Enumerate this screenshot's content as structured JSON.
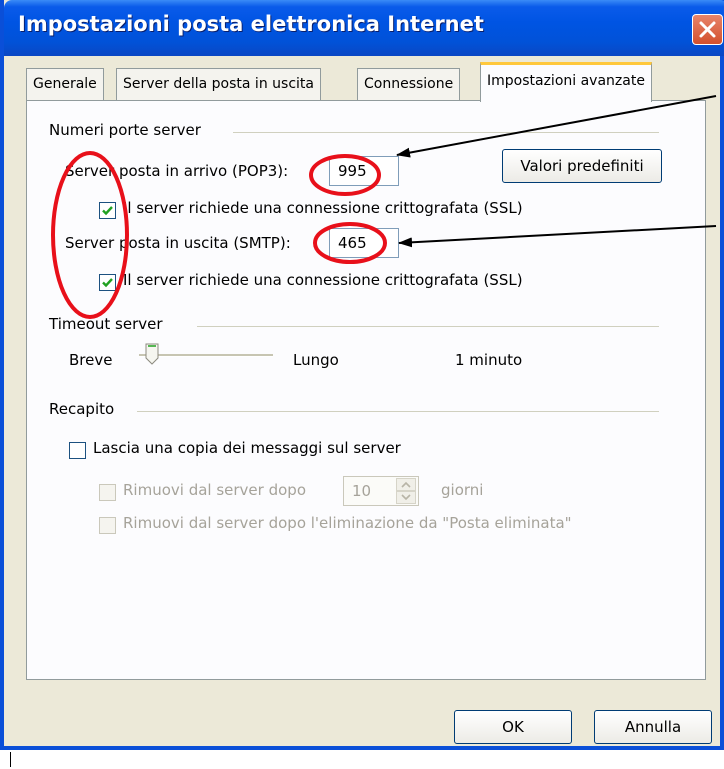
{
  "window": {
    "title": "Impostazioni posta elettronica Internet"
  },
  "tabs": [
    {
      "label": "Generale",
      "active": false
    },
    {
      "label": "Server della posta in uscita",
      "active": false
    },
    {
      "label": "Connessione",
      "active": false
    },
    {
      "label": "Impostazioni avanzate",
      "active": true
    }
  ],
  "ports": {
    "group_label": "Numeri porte server",
    "incoming_label": "Server posta in arrivo (POP3):",
    "incoming_value": "995",
    "incoming_ssl_label": "Il server richiede una connessione crittografata (SSL)",
    "incoming_ssl_checked": true,
    "outgoing_label": "Server posta in uscita (SMTP):",
    "outgoing_value": "465",
    "outgoing_ssl_label": "Il server richiede una connessione crittografata (SSL)",
    "outgoing_ssl_checked": true,
    "defaults_button": "Valori predefiniti"
  },
  "timeout": {
    "group_label": "Timeout server",
    "short_label": "Breve",
    "long_label": "Lungo",
    "value_text": "1 minuto",
    "slider_level": 0.1
  },
  "delivery": {
    "group_label": "Recapito",
    "leave_copy_label": "Lascia una copia dei messaggi sul server",
    "leave_copy_checked": false,
    "remove_after_label": "Rimuovi dal server dopo",
    "remove_after_value": "10",
    "days_label": "giorni",
    "remove_deleted_label": "Rimuovi dal server dopo l'eliminazione da \"Posta eliminata\""
  },
  "footer": {
    "ok_label": "OK",
    "cancel_label": "Annulla"
  },
  "colors": {
    "title_bar": "#0054e3",
    "annotation_red": "#e8101a",
    "active_tab_accent": "#ffc83c"
  },
  "icons": {
    "close": "close-icon",
    "check": "check-icon",
    "spin_up": "chevron-up-icon",
    "spin_down": "chevron-down-icon"
  }
}
